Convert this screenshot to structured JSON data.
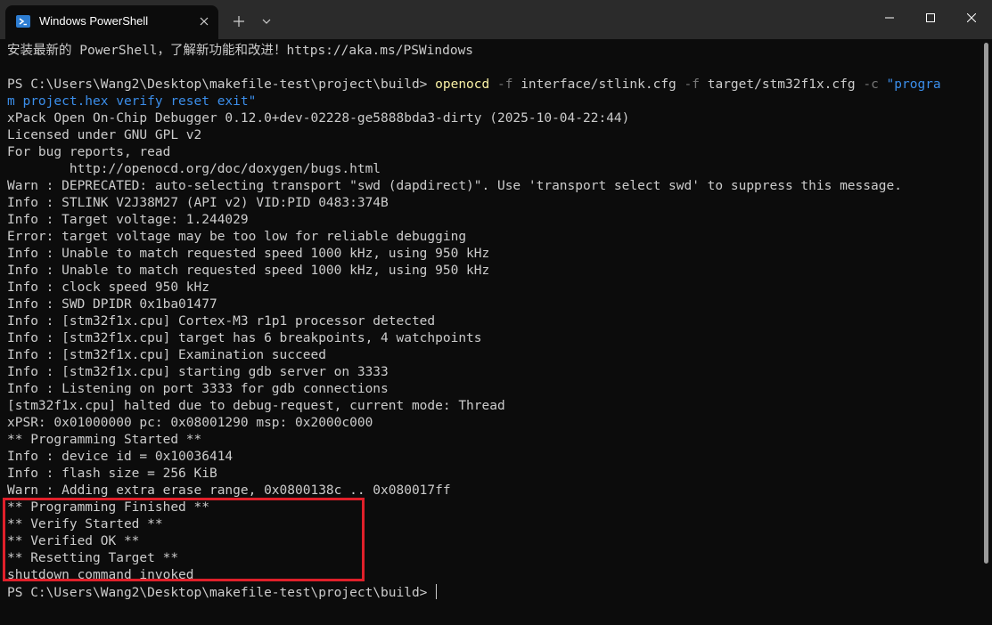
{
  "window": {
    "tab_title": "Windows PowerShell",
    "tab_icon": "powershell-icon"
  },
  "colors": {
    "background": "#0c0c0c",
    "titlebar": "#2b2b2b",
    "text": "#cccccc",
    "command": "#f9f1a5",
    "flag": "#767676",
    "string": "#3b8eea",
    "highlight_box": "#e0202a"
  },
  "terminal": {
    "banner": "安装最新的 PowerShell，了解新功能和改进！https://aka.ms/PSWindows",
    "prompt": "PS C:\\Users\\Wang2\\Desktop\\makefile-test\\project\\build> ",
    "command": {
      "exe": "openocd",
      "flag1": "-f",
      "arg1": "interface/stlink.cfg",
      "flag2": "-f",
      "arg2": "target/stm32f1x.cfg",
      "flag3": "-c",
      "str_part1": "\"progra",
      "str_part2": "m project.hex verify reset exit\""
    },
    "output_lines": [
      "xPack Open On-Chip Debugger 0.12.0+dev-02228-ge5888bda3-dirty (2025-10-04-22:44)",
      "Licensed under GNU GPL v2",
      "For bug reports, read",
      "        http://openocd.org/doc/doxygen/bugs.html",
      "Warn : DEPRECATED: auto-selecting transport \"swd (dapdirect)\". Use 'transport select swd' to suppress this message.",
      "Info : STLINK V2J38M27 (API v2) VID:PID 0483:374B",
      "Info : Target voltage: 1.244029",
      "Error: target voltage may be too low for reliable debugging",
      "Info : Unable to match requested speed 1000 kHz, using 950 kHz",
      "Info : Unable to match requested speed 1000 kHz, using 950 kHz",
      "Info : clock speed 950 kHz",
      "Info : SWD DPIDR 0x1ba01477",
      "Info : [stm32f1x.cpu] Cortex-M3 r1p1 processor detected",
      "Info : [stm32f1x.cpu] target has 6 breakpoints, 4 watchpoints",
      "Info : [stm32f1x.cpu] Examination succeed",
      "Info : [stm32f1x.cpu] starting gdb server on 3333",
      "Info : Listening on port 3333 for gdb connections",
      "[stm32f1x.cpu] halted due to debug-request, current mode: Thread",
      "xPSR: 0x01000000 pc: 0x08001290 msp: 0x2000c000",
      "** Programming Started **",
      "Info : device id = 0x10036414",
      "Info : flash size = 256 KiB",
      "Warn : Adding extra erase range, 0x0800138c .. 0x080017ff",
      "** Programming Finished **",
      "** Verify Started **",
      "** Verified OK **",
      "** Resetting Target **",
      "shutdown command invoked"
    ],
    "final_prompt": "PS C:\\Users\\Wang2\\Desktop\\makefile-test\\project\\build> "
  }
}
